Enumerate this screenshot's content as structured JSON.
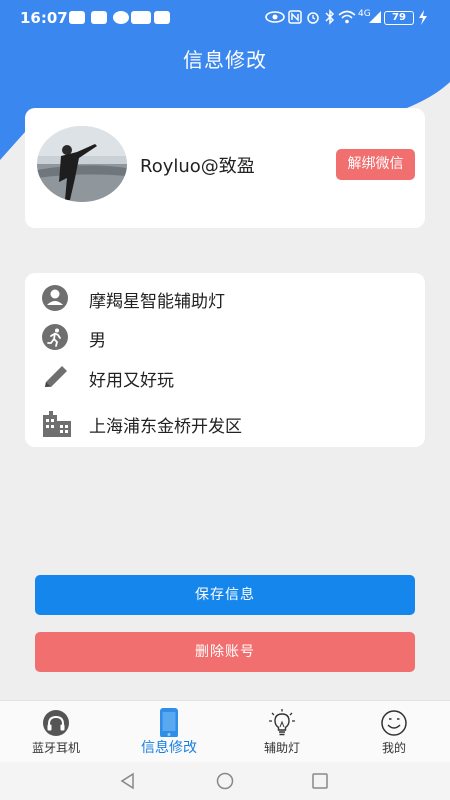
{
  "status_bar": {
    "time": "16:07",
    "battery": "79",
    "network": "4G"
  },
  "header": {
    "title": "信息修改"
  },
  "profile": {
    "nickname": "Royluo@致盈",
    "unbind_label": "解绑微信"
  },
  "info": {
    "rows": [
      {
        "icon": "user-circle-icon",
        "text": "摩羯星智能辅助灯"
      },
      {
        "icon": "runner-icon",
        "text": "男"
      },
      {
        "icon": "pencil-icon",
        "text": "好用又好玩"
      },
      {
        "icon": "building-icon",
        "text": "上海浦东金桥开发区"
      }
    ]
  },
  "actions": {
    "save_label": "保存信息",
    "delete_label": "删除账号"
  },
  "tabs": [
    {
      "label": "蓝牙耳机",
      "icon": "headphones-icon"
    },
    {
      "label": "信息修改",
      "icon": "phone-icon",
      "active": true
    },
    {
      "label": "辅助灯",
      "icon": "lightbulb-icon"
    },
    {
      "label": "我的",
      "icon": "smiley-icon"
    }
  ],
  "colors": {
    "primary": "#3b87f0",
    "danger": "#f26f6f",
    "save": "#1586ec",
    "active_tab": "#1a7fe0"
  }
}
